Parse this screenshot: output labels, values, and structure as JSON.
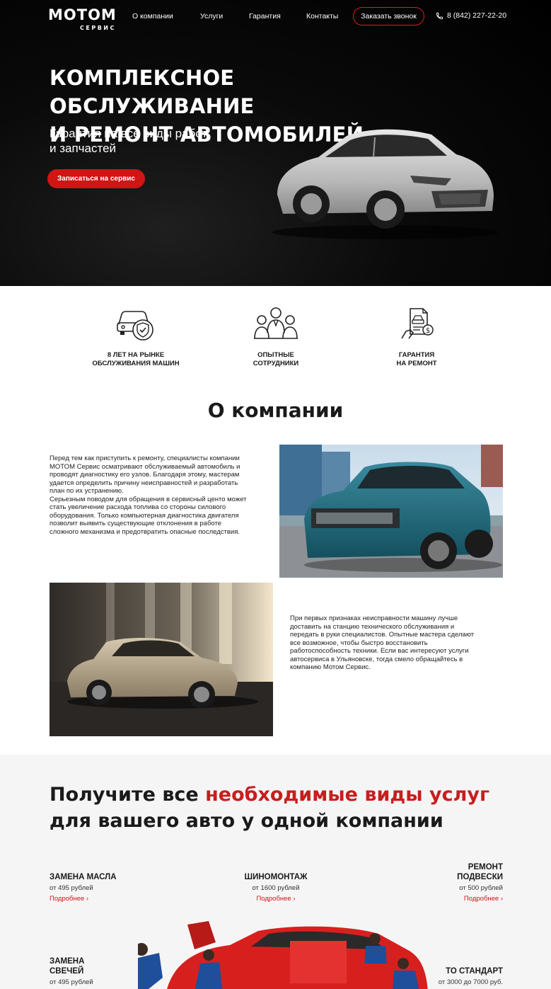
{
  "header": {
    "logo_main": "МОТОМ",
    "logo_sub": "СЕРВИС",
    "nav": [
      "О компании",
      "Услуги",
      "Гарантия",
      "Контакты"
    ],
    "callback_label": "Заказать звонок",
    "phone": "8 (842) 227-22-20"
  },
  "hero": {
    "title_line1": "КОМПЛЕКСНОЕ ОБСЛУЖИВАНИЕ",
    "title_line2": "И РЕМОНТ АВТОМОБИЛЕЙ",
    "subtitle_line1": "Гарантия на все виды работ",
    "subtitle_line2": "и запчастей",
    "button_label": "Записаться на сервис"
  },
  "features": [
    {
      "line1": "8 ЛЕТ НА РЫНКЕ",
      "line2": "ОБСЛУЖИВАНИЯ МАШИН",
      "icon": "car-shield-icon"
    },
    {
      "line1": "ОПЫТНЫЕ",
      "line2": "СОТРУДНИКИ",
      "icon": "team-icon"
    },
    {
      "line1": "ГАРАНТИЯ",
      "line2": "НА РЕМОНТ",
      "icon": "warranty-document-icon"
    }
  ],
  "about": {
    "title": "О компании",
    "paragraph1": "Перед тем как приступить к ремонту, специалисты компании МОТОМ Сервис осматривают обслуживаемый автомобиль и проводят диагностику его узлов. Благодаря этому, мастерам удается определить причину неисправностей и разработать план по их устранению.",
    "paragraph2": "Серьезным поводом для обращения в сервисный центо может стать увеличение расхода топлива со стороны силового оборудования. Только компьютерная диагностика двигателя позволит выявить существующие отклонения в работе сложного механизма и предотвратить опасные последствия.",
    "paragraph3": "При первых признаках неисправности машину лучше доставить на станцию технического обслуживания и передать в руки специалистов. Опытные мастера сделают все возможное, чтобы быстро восстановить работоспособность техники. Если вас интересуют услуги автосервиса в Ульяновске, тогда смело обращайтесь в компанию Мотом Сервис."
  },
  "services": {
    "title_part1": "Получите все ",
    "title_highlight": "необходимые виды услуг",
    "title_line2": "для вашего авто у одной компании",
    "items": [
      {
        "name": "ЗАМЕНА МАСЛА",
        "price": "от 495 рублей",
        "more": "Подробнее ›"
      },
      {
        "name": "ШИНОМОНТАЖ",
        "price": "от 1600 рублей",
        "more": "Подробнее ›"
      },
      {
        "name_line1": "РЕМОНТ",
        "name_line2": "ПОДВЕСКИ",
        "price": "от 500 рублей",
        "more": "Подробнее ›"
      },
      {
        "name_line1": "ЗАМЕНА",
        "name_line2": "СВЕЧЕЙ",
        "price": "от 495 рублей"
      },
      {
        "name": "ТО СТАНДАРТ",
        "price": "от 3000 до 7000 руб."
      }
    ]
  },
  "colors": {
    "accent": "#d11414",
    "dark": "#000000",
    "light_bg": "#f5f5f5"
  }
}
